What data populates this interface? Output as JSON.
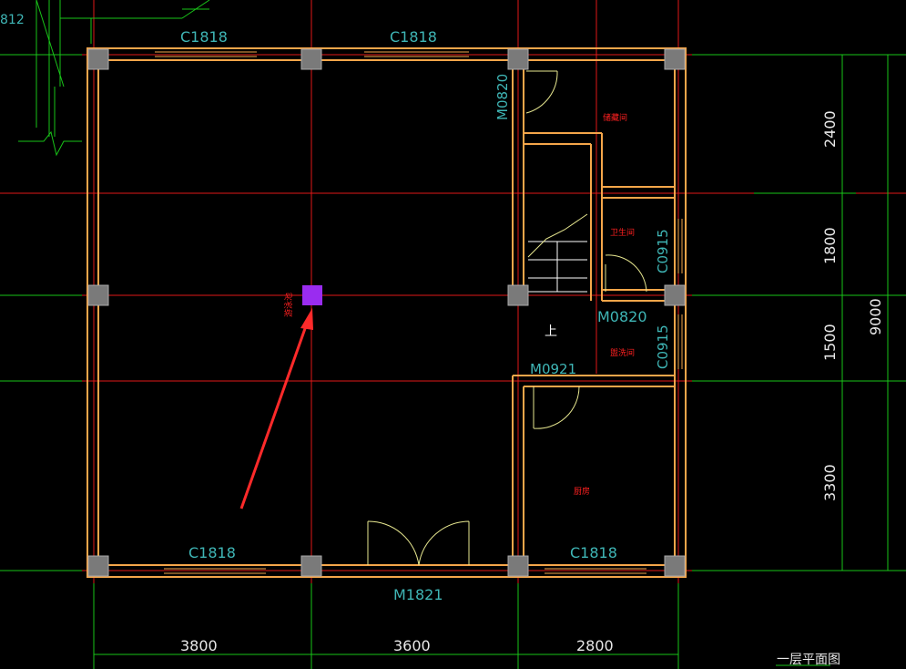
{
  "window_labels": [
    "C1818",
    "C1818",
    "C1818",
    "C1818",
    "C0915",
    "C0915"
  ],
  "door_labels": [
    "M0820",
    "M0820",
    "M0921",
    "M1821"
  ],
  "top_left_fragment": "812",
  "stair_mark": "上",
  "room_labels": [
    "储藏间",
    "卫生间",
    "盥洗间",
    "厨房",
    "游泳池"
  ],
  "dims_bottom": [
    "3800",
    "3600",
    "2800"
  ],
  "dims_right": [
    "2400",
    "1800",
    "1500",
    "3300"
  ],
  "dim_total": "9000",
  "drawing_title": "一层平面图",
  "colors": {
    "background": "#000000",
    "wall": "#f5a64a",
    "axis_red": "#e01818",
    "dim_green": "#19c419",
    "label_cyan": "#3fb6b6",
    "door_yellow": "#e8e890",
    "column": "#7a7a7a",
    "marker": "#9a2cf0",
    "arrow": "#ff2a2a"
  }
}
